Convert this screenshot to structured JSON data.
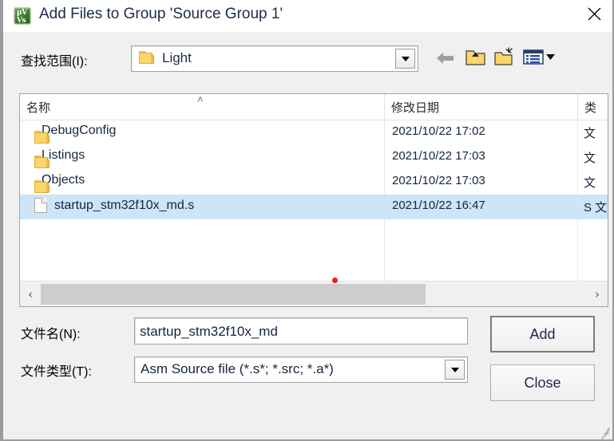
{
  "window": {
    "title": "Add Files to Group 'Source Group 1'",
    "app_icon": "keil-uvision-icon",
    "icon_glyph_top": "µV",
    "icon_glyph_bottom": "Vs",
    "close_label": "×"
  },
  "lookin": {
    "label": "查找范围(I):",
    "value": "Light",
    "folder_icon": "folder-icon",
    "dropdown_icon": "chevron-down-icon"
  },
  "toolbar": {
    "back": "back-arrow-icon",
    "up": "up-one-level-icon",
    "new_folder": "new-folder-icon",
    "views": "views-icon",
    "views_dropdown": "chevron-down-icon"
  },
  "list": {
    "columns": [
      {
        "label": "名称",
        "sort": "˄"
      },
      {
        "label": "修改日期",
        "sort": ""
      },
      {
        "label": "类",
        "sort": ""
      }
    ],
    "rows": [
      {
        "name": "DebugConfig",
        "date": "2021/10/22 17:02",
        "type": "文",
        "icon": "folder-icon",
        "selected": false
      },
      {
        "name": "Listings",
        "date": "2021/10/22 17:03",
        "type": "文",
        "icon": "folder-icon",
        "selected": false
      },
      {
        "name": "Objects",
        "date": "2021/10/22 17:03",
        "type": "文",
        "icon": "folder-icon",
        "selected": false
      },
      {
        "name": "startup_stm32f10x_md.s",
        "date": "2021/10/22 16:47",
        "type": "S 文",
        "icon": "file-icon",
        "selected": true
      }
    ],
    "scrollbar": {
      "left_arrow": "‹",
      "right_arrow": "›",
      "thumb_percent": 70
    }
  },
  "form": {
    "filename_label": "文件名(N):",
    "filename_value": "startup_stm32f10x_md",
    "filename_placeholder": "",
    "filetype_label": "文件类型(T):",
    "filetype_value": "Asm Source file (*.s*; *.src; *.a*)",
    "filetype_dropdown": "chevron-down-icon"
  },
  "buttons": {
    "add": "Add",
    "close": "Close"
  },
  "colors": {
    "selection": "#cce5f7",
    "dialog_bg": "#f0f0f0",
    "text": "#14253f",
    "cursor_dot": "#ee1c1c",
    "folder_yellow": "#fcd66a",
    "icon_green": "#3d7a2a"
  }
}
